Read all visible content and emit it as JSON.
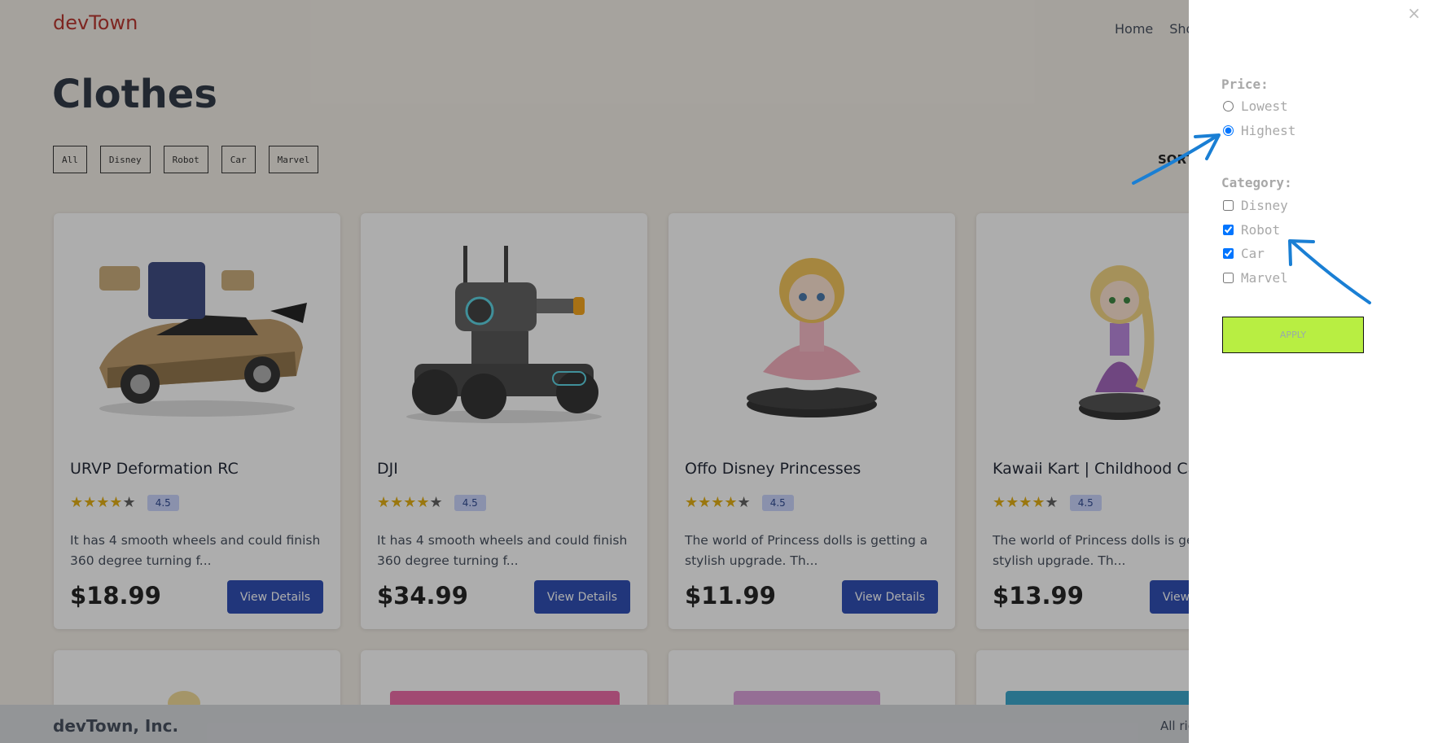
{
  "header": {
    "brand": "devTown",
    "nav": [
      "Home",
      "Shop"
    ]
  },
  "page_title": "Clothes",
  "filters": [
    "All",
    "Disney",
    "Robot",
    "Car",
    "Marvel"
  ],
  "sort_label": "SORT",
  "products": [
    {
      "title": "URVP Deformation RC",
      "rating": "4.5",
      "stars": 4,
      "description": "It has 4 smooth wheels and could finish 360 degree turning f...",
      "price": "$18.99",
      "button": "View Details",
      "image_icon": "robot-car-image"
    },
    {
      "title": "DJI",
      "rating": "4.5",
      "stars": 4,
      "description": "It has 4 smooth wheels and could finish 360 degree turning f...",
      "price": "$34.99",
      "button": "View Details",
      "image_icon": "robot-tank-image"
    },
    {
      "title": "Offo Disney Princesses",
      "rating": "4.5",
      "stars": 4,
      "description": "The world of Princess dolls is getting a stylish upgrade. Th...",
      "price": "$11.99",
      "button": "View Details",
      "image_icon": "princess-doll-image"
    },
    {
      "title": "Kawaii Kart | Childhood Cartoon",
      "rating": "4.5",
      "stars": 4,
      "description": "The world of Princess dolls is getting a stylish upgrade. Th...",
      "price": "$13.99",
      "button": "View Details",
      "image_icon": "rapunzel-doll-image"
    }
  ],
  "footer": {
    "brand": "devTown, Inc.",
    "rights": "All rights reserved."
  },
  "drawer": {
    "close": "×",
    "price_label": "Price:",
    "price_options": [
      {
        "label": "Lowest",
        "selected": false
      },
      {
        "label": "Highest",
        "selected": true
      }
    ],
    "category_label": "Category:",
    "category_options": [
      {
        "label": "Disney",
        "checked": false
      },
      {
        "label": "Robot",
        "checked": true
      },
      {
        "label": "Car",
        "checked": true
      },
      {
        "label": "Marvel",
        "checked": false
      }
    ],
    "apply": "APPLY"
  },
  "colors": {
    "brand": "#b3261e",
    "button": "#1e40af",
    "apply": "#b8ee42",
    "annotation": "#1a7fd4"
  }
}
